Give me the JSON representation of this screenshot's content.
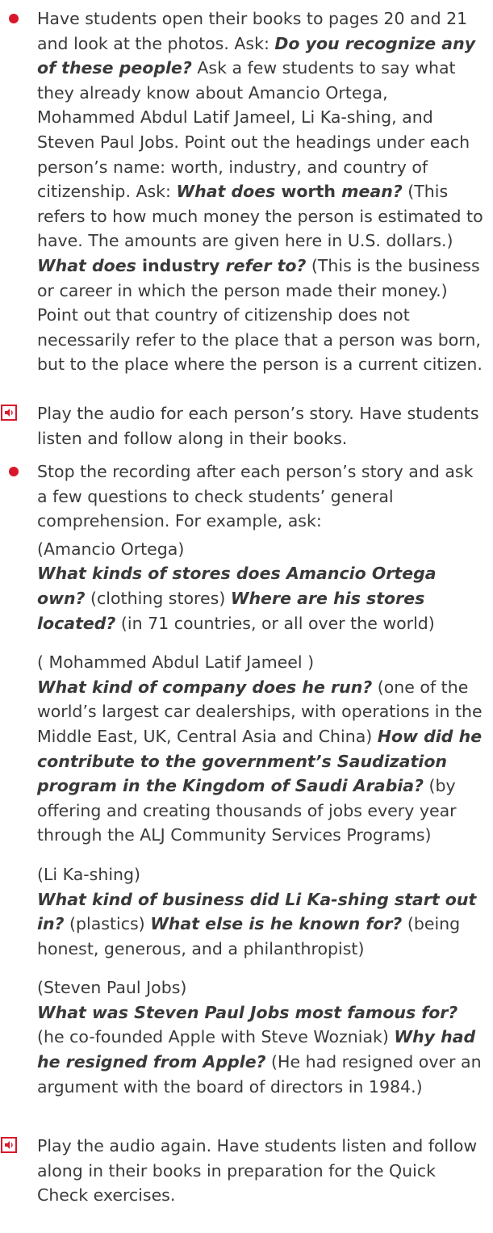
{
  "item1": {
    "t1": "Have students open their books to pages 20 and 21 and look at the photos. Ask: ",
    "q1": "Do you recognize any of these people?",
    "t2": " Ask a few students to say what they already know about Amancio Ortega, Mohammed Abdul Latif Jameel, Li Ka-shing, and Steven Paul Jobs. Point out the headings under each person’s name: worth, industry, and country of citizenship. Ask: ",
    "q2a": "What does",
    "q2b": " worth ",
    "q2c": "mean?",
    "t3": " (This refers to how much money the person is estimated to have. The amounts are given here in U.S. dollars.) ",
    "q3a": "What does",
    "q3b": " industry ",
    "q3c": "refer to?",
    "t4": " (This is the business or career in which the person made their money.) Point out that country of citizenship does not necessarily refer to the place that a person was born, but to the place where the person is a current citizen."
  },
  "item2": {
    "text": "Play the audio for each person’s story. Have students listen and follow along in their books."
  },
  "item3": {
    "text": "Stop the recording after each person’s story and ask a few questions to check students’ general comprehension. For example, ask:",
    "p1": {
      "name": "(Amancio Ortega)",
      "q1": "What kinds of stores does Amancio Ortega own?",
      "a1": " (clothing stores) ",
      "q2": "Where are his stores located?",
      "a2": " (in 71 countries, or all over the world)"
    },
    "p2": {
      "name": "( Mohammed Abdul Latif Jameel )",
      "q1": "What kind of company does he run?",
      "a1": " (one of the world’s largest car dealerships, with operations in the Middle East, UK, Central Asia and China) ",
      "q2": "How did he contribute to the government’s Saudization program in the Kingdom of Saudi Arabia?",
      "a2": " (by offering and creating thousands of jobs every year through the ALJ Community Services Programs)"
    },
    "p3": {
      "name": "(Li Ka-shing)",
      "q1": "What kind of business did Li Ka-shing start out in?",
      "a1": " (plastics) ",
      "q2": "What else is he known for?",
      "a2": " (being honest, generous, and a philanthropist)"
    },
    "p4": {
      "name": "(Steven Paul Jobs)",
      "q1": "What was Steven Paul Jobs most famous for?",
      "a1": " (he co-founded Apple with Steve Wozniak) ",
      "q2": "Why had he resigned  from Apple?",
      "a2": " (He had resigned over an argument with the board of directors in 1984.)"
    }
  },
  "item4": {
    "text": "Play the audio again. Have students listen and follow along in their books in preparation for the Quick Check exercises."
  },
  "colors": {
    "accent": "#d8172a",
    "text": "#3a3a3a"
  },
  "icons": {
    "bullet": "red-bullet-icon",
    "audio": "audio-speaker-icon"
  }
}
